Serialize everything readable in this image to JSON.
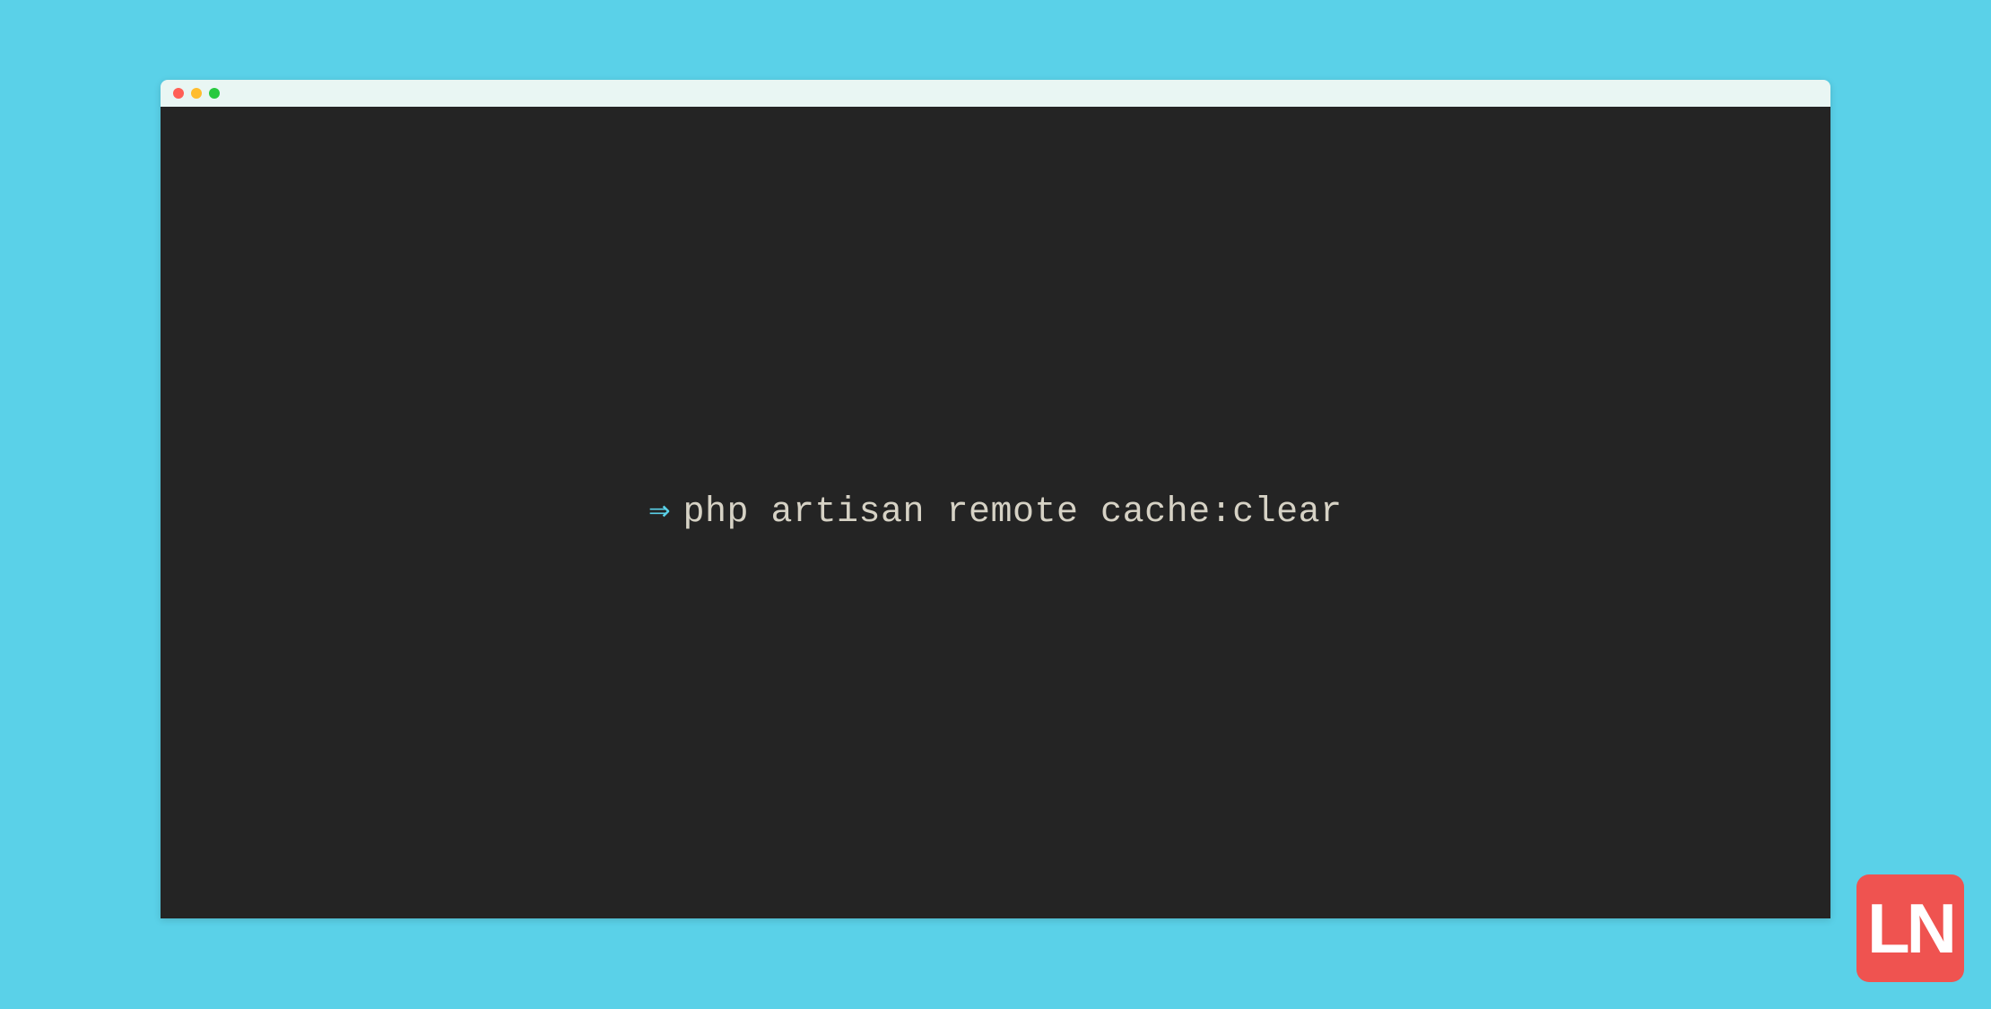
{
  "terminal": {
    "prompt_symbol": "⇒",
    "command": "php artisan remote cache:clear"
  },
  "logo": {
    "text": "LN"
  },
  "colors": {
    "background": "#5ad1e8",
    "terminal_bg": "#242424",
    "titlebar_bg": "#e9f6f3",
    "command_text": "#d6d2c5",
    "prompt_color": "#5ad1e8",
    "logo_bg": "#ef5350",
    "traffic_red": "#ff5f56",
    "traffic_yellow": "#ffbd2e",
    "traffic_green": "#27c93f"
  }
}
